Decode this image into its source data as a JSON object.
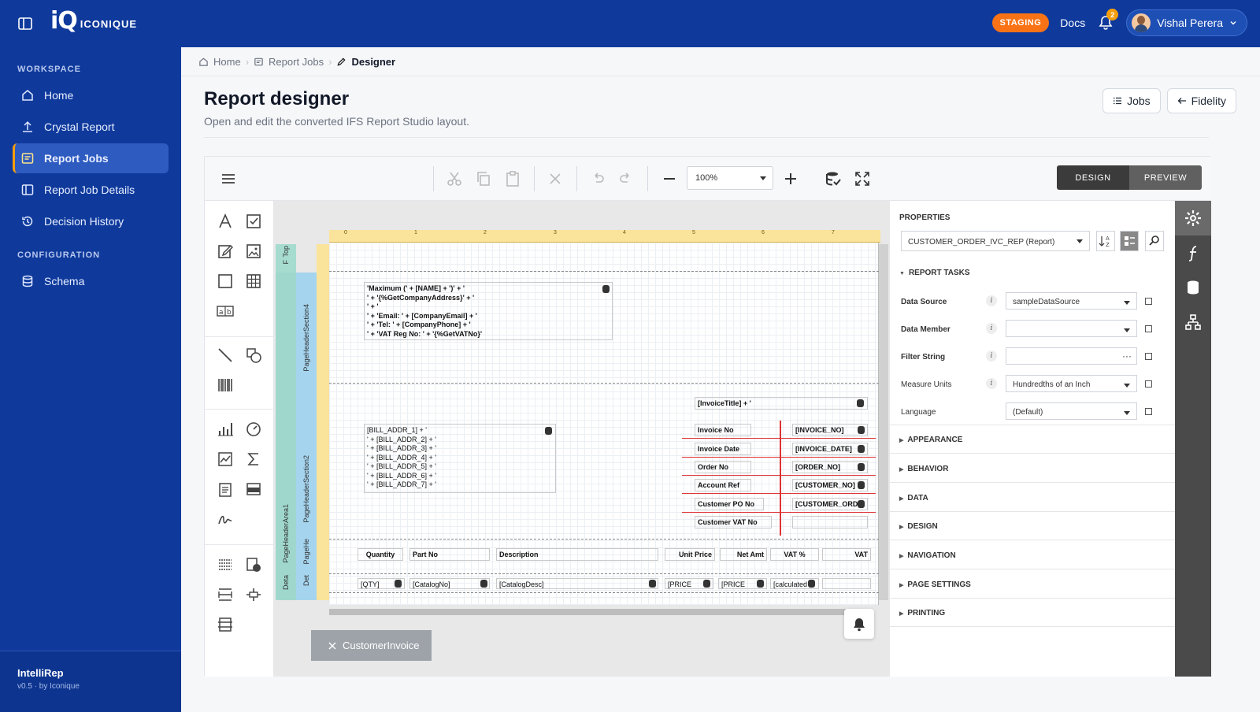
{
  "topbar": {
    "logo_mark": "iQ",
    "logo_text": "ICONIQUE",
    "env_badge": "STAGING",
    "docs_label": "Docs",
    "notifications_count": "2",
    "user_name": "Vishal Perera"
  },
  "sidebar": {
    "workspace_label": "WORKSPACE",
    "workspace_items": [
      {
        "label": "Home",
        "icon": "home-icon"
      },
      {
        "label": "Crystal Report",
        "icon": "upload-icon"
      },
      {
        "label": "Report Jobs",
        "icon": "report-icon",
        "active": true
      },
      {
        "label": "Report Job Details",
        "icon": "panel-icon"
      },
      {
        "label": "Decision History",
        "icon": "history-icon"
      }
    ],
    "config_label": "CONFIGURATION",
    "config_items": [
      {
        "label": "Schema",
        "icon": "database-icon"
      }
    ],
    "footer_title": "IntelliRep",
    "footer_sub": "v0.5 · by Iconique"
  },
  "breadcrumb": [
    "Home",
    "Report Jobs",
    "Designer"
  ],
  "page": {
    "title": "Report designer",
    "subtitle": "Open and edit the converted IFS Report Studio layout.",
    "jobs_button": "Jobs",
    "fidelity_button": "Fidelity"
  },
  "designer": {
    "zoom": "100%",
    "mode_design": "DESIGN",
    "mode_preview": "PREVIEW",
    "ruler_labels": [
      "0",
      "1",
      "2",
      "3",
      "4",
      "5",
      "6",
      "7"
    ],
    "bands": {
      "top": "Top",
      "f": "F",
      "page_header_section4": "PageHeaderSection4",
      "page_header_section2": "PageHeaderSection2",
      "page_header_area1": "PageHeaderArea1",
      "page_he": "PageHe",
      "deta": "Deta",
      "det": "Det"
    },
    "controls": {
      "company_block": "'Maximum (' + [NAME] + ')' + '\n' + '{%GetCompanyAddress}' + '\n' + '\n' + 'Email: ' + [CompanyEmail] + '\n' + 'Tel: ' + [CompanyPhone] + '\n' + 'VAT Reg No: ' + '{%GetVATNo}'",
      "bill_addr_block": "[BILL_ADDR_1] + '\n' + [BILL_ADDR_2] + '\n' + [BILL_ADDR_3] + '\n' + [BILL_ADDR_4] + '\n' + [BILL_ADDR_5] + '\n' + [BILL_ADDR_6] + '\n' + [BILL_ADDR_7] + '",
      "invoice_title": "[InvoiceTitle] + '",
      "labels": [
        "Invoice No",
        "Invoice Date",
        "Order No",
        "Account Ref",
        "Customer PO No",
        "Customer VAT No"
      ],
      "values": [
        "[INVOICE_NO]",
        "[INVOICE_DATE]",
        "[ORDER_NO]",
        "[CUSTOMER_NO]",
        "[CUSTOMER_ORD",
        ""
      ],
      "column_headers": [
        "Quantity",
        "Part No",
        "Description",
        "Unit Price",
        "Net Amt",
        "VAT %",
        "VAT"
      ],
      "detail_fields": [
        "[QTY]",
        "[CatalogNo]",
        "[CatalogDesc]",
        "[PRICE",
        "[PRICE",
        "[calculated"
      ]
    },
    "report_tab": "CustomerInvoice"
  },
  "properties": {
    "title": "PROPERTIES",
    "selected_object": "CUSTOMER_ORDER_IVC_REP (Report)",
    "report_tasks": "REPORT TASKS",
    "rows": [
      {
        "label": "Data Source",
        "value": "sampleDataSource",
        "bold": true
      },
      {
        "label": "Data Member",
        "value": "",
        "bold": true
      },
      {
        "label": "Filter String",
        "value": "",
        "bold": true
      },
      {
        "label": "Measure Units",
        "value": "Hundredths of an Inch",
        "bold": false
      },
      {
        "label": "Language",
        "value": "(Default)",
        "bold": false
      }
    ],
    "sections": [
      "APPEARANCE",
      "BEHAVIOR",
      "DATA",
      "DESIGN",
      "NAVIGATION",
      "PAGE SETTINGS",
      "PRINTING"
    ]
  }
}
